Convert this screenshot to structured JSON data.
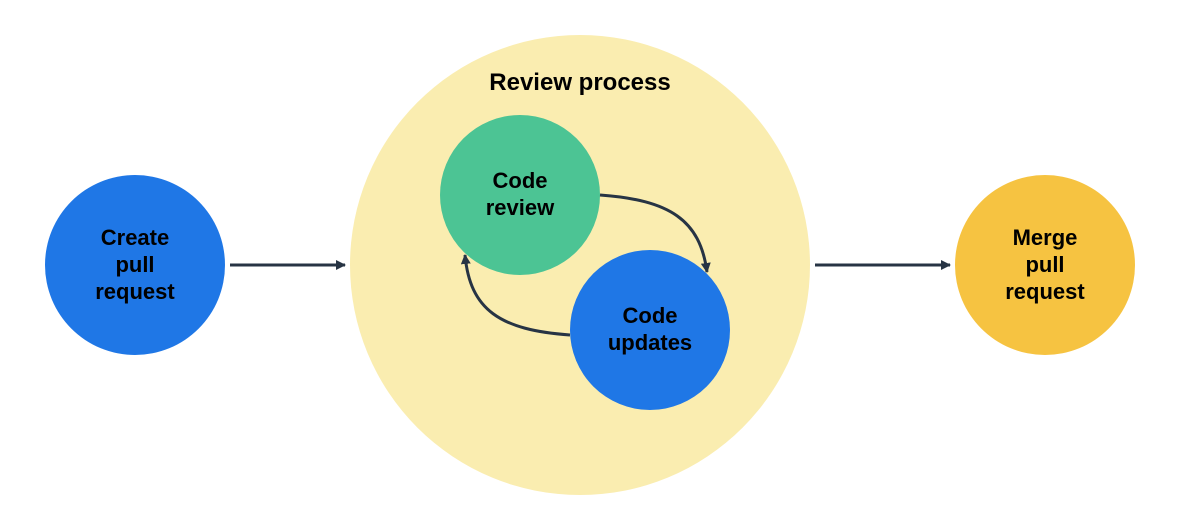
{
  "diagram": {
    "title": "Review process",
    "nodes": {
      "create": {
        "label_l1": "Create",
        "label_l2": "pull",
        "label_l3": "request"
      },
      "review": {
        "label_l1": "Code",
        "label_l2": "review"
      },
      "updates": {
        "label_l1": "Code",
        "label_l2": "updates"
      },
      "merge": {
        "label_l1": "Merge",
        "label_l2": "pull",
        "label_l3": "request"
      }
    },
    "colors": {
      "blue": "#1f77e6",
      "green": "#4cc494",
      "yellow": "#f6c341",
      "cream": "#faedb0",
      "stroke": "#273444"
    }
  }
}
